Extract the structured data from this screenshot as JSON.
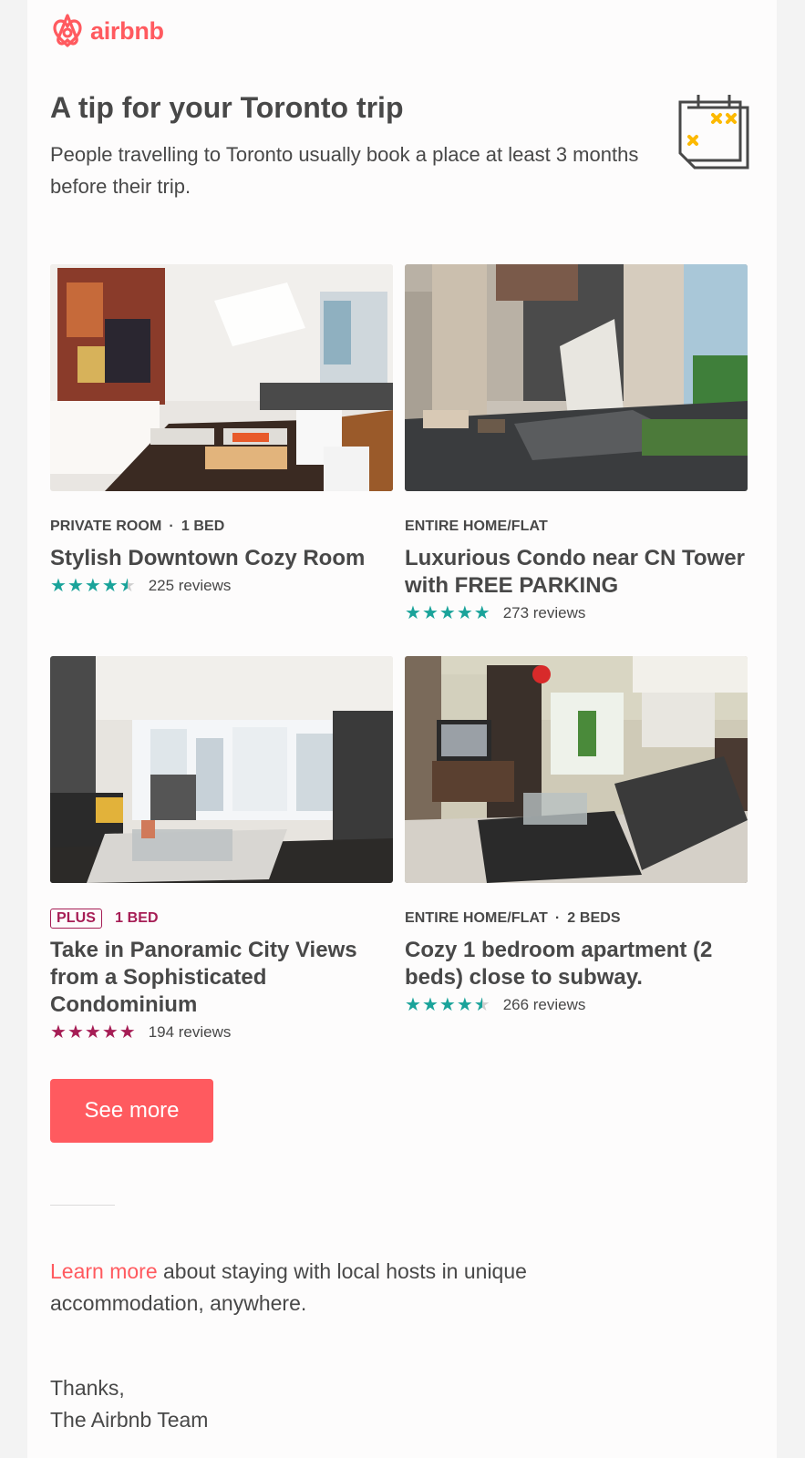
{
  "brand": {
    "name": "airbnb",
    "color": "#ff5a5f",
    "logo_icon": "airbnb-belo-icon"
  },
  "tip": {
    "headline": "A tip for your Toronto trip",
    "body": "People travelling to Toronto usually book a place at least 3 months before their trip.",
    "icon": "calendar-icon"
  },
  "listings": [
    {
      "room_type": "PRIVATE ROOM",
      "separator": "·",
      "beds": "1 BED",
      "title": "Stylish Downtown Cozy Room",
      "rating_stars": 4.5,
      "star_color": "#1aa39a",
      "reviews": "225 reviews",
      "photo": "dining-room-photo"
    },
    {
      "room_type": "ENTIRE HOME/FLAT",
      "title": "Luxurious Condo near CN Tower with FREE PARKING",
      "rating_stars": 5,
      "star_color": "#1aa39a",
      "reviews": "273 reviews",
      "photo": "condo-lobby-photo"
    },
    {
      "badge": "PLUS",
      "beds": "1 BED",
      "title": "Take in Panoramic City Views from a Sophisticated Condominium",
      "rating_stars": 5,
      "star_color": "#a61d55",
      "reviews": "194 reviews",
      "photo": "living-room-view-photo"
    },
    {
      "room_type": "ENTIRE HOME/FLAT",
      "separator": "·",
      "beds": "2 BEDS",
      "title": "Cozy 1 bedroom apartment (2 beds) close to subway.",
      "rating_stars": 4.5,
      "star_color": "#1aa39a",
      "reviews": "266 reviews",
      "photo": "apartment-living-photo"
    }
  ],
  "see_more_label": "See more",
  "learn_more": {
    "link": "Learn more",
    "rest": " about staying with local hosts in unique accommodation, anywhere."
  },
  "signoff": {
    "line1": "Thanks,",
    "line2": "The Airbnb Team"
  }
}
